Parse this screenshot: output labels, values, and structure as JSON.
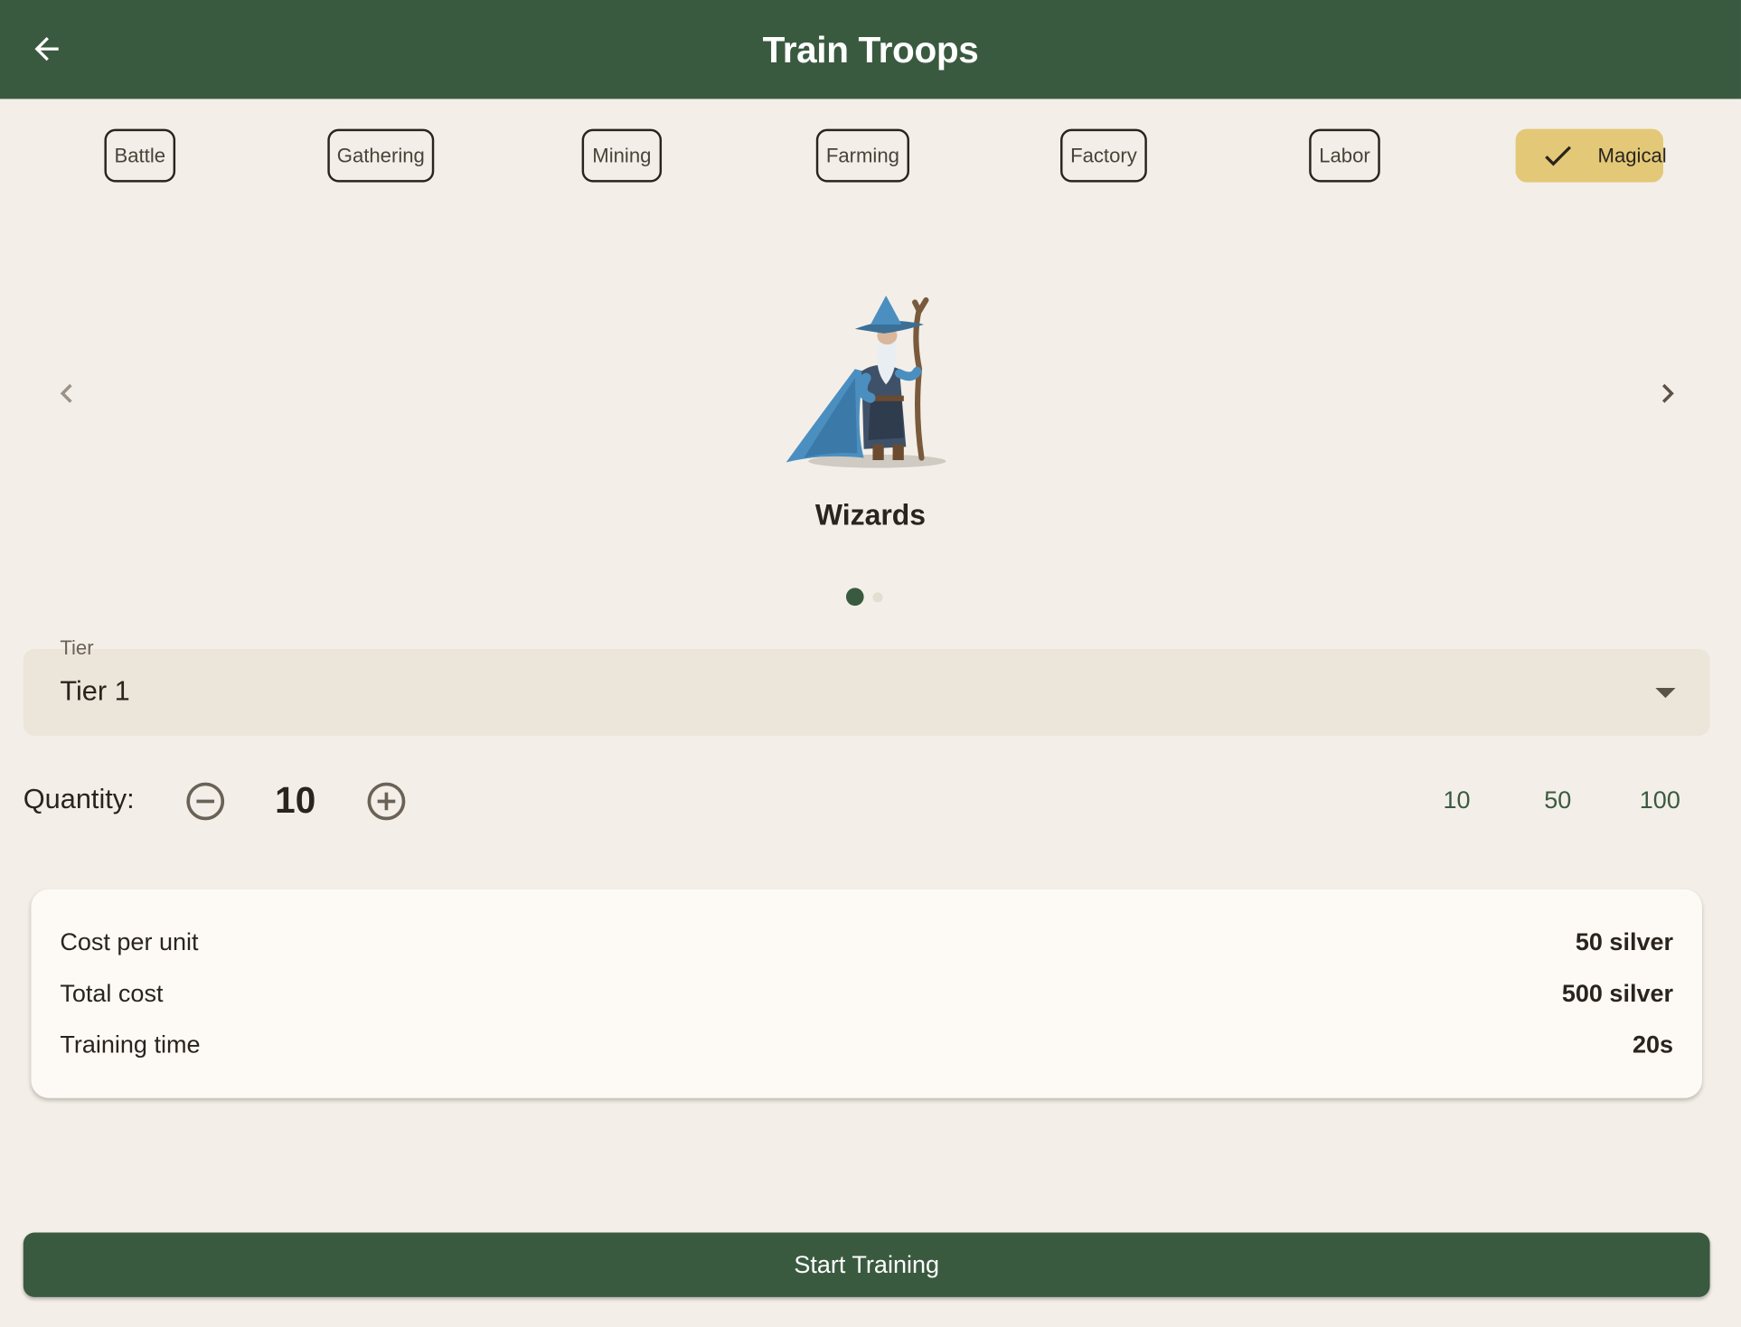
{
  "app_bar": {
    "title": "Train Troops",
    "back_icon": "arrow-back-icon"
  },
  "categories": [
    {
      "label": "Battle",
      "selected": false
    },
    {
      "label": "Gathering",
      "selected": false
    },
    {
      "label": "Mining",
      "selected": false
    },
    {
      "label": "Farming",
      "selected": false
    },
    {
      "label": "Factory",
      "selected": false
    },
    {
      "label": "Labor",
      "selected": false
    },
    {
      "label": "Magical",
      "selected": true
    }
  ],
  "carousel": {
    "troop_name": "Wizards",
    "page_count": 2,
    "current_page": 1,
    "prev_icon": "chevron-left-icon",
    "next_icon": "chevron-right-icon"
  },
  "tier": {
    "label": "Tier",
    "value": "Tier 1"
  },
  "quantity": {
    "label": "Quantity:",
    "value": "10",
    "presets": [
      "10",
      "50",
      "100"
    ]
  },
  "summary": {
    "cost_per_unit_label": "Cost per unit",
    "cost_per_unit_value": "50 silver",
    "total_cost_label": "Total cost",
    "total_cost_value": "500 silver",
    "training_time_label": "Training time",
    "training_time_value": "20s"
  },
  "start_button": {
    "label": "Start Training"
  },
  "colors": {
    "primary": "#3a5a40",
    "selected_chip": "#e3c878",
    "background": "#f3efe8",
    "card": "#fdfaf5"
  }
}
